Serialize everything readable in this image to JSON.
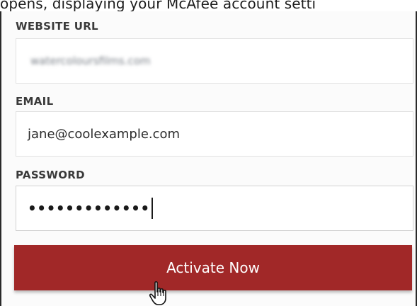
{
  "caption": {
    "text": "opens, displaying your McAfee account setti"
  },
  "form": {
    "website_url": {
      "label": "WEBSITE URL",
      "value": "watercoloursfilms.com"
    },
    "email": {
      "label": "EMAIL",
      "value": "jane@coolexample.com"
    },
    "password": {
      "label": "PASSWORD",
      "value": "•••••••••••••"
    },
    "submit": {
      "label": "Activate Now"
    }
  },
  "colors": {
    "button_bg": "#a12828",
    "button_text": "#ffffff",
    "label_text": "#3a3a3a"
  },
  "icons": {
    "cursor": "hand-pointer-icon"
  }
}
